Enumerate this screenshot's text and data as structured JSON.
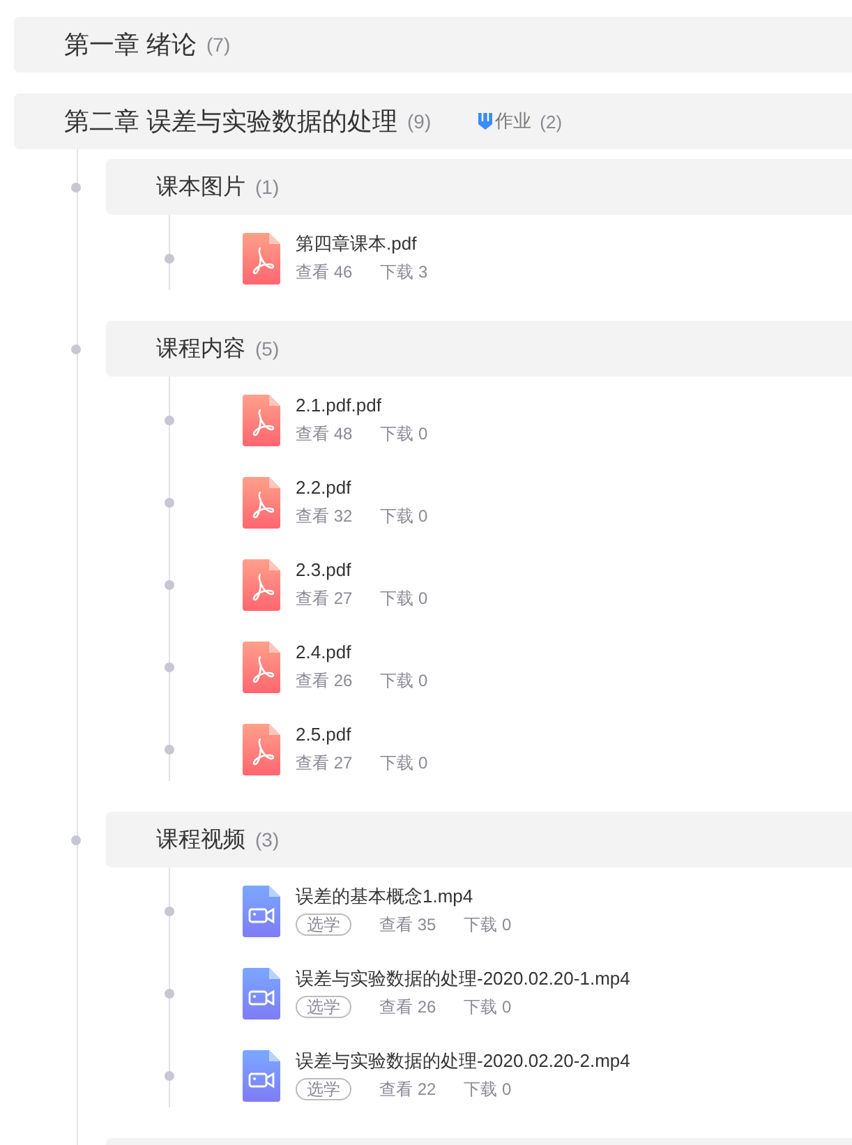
{
  "chapters": [
    {
      "title": "第一章 绪论",
      "count": "(7)"
    },
    {
      "title": "第二章 误差与实验数据的处理",
      "count": "(9)",
      "homework": {
        "label": "作业",
        "count": "(2)"
      },
      "sections": [
        {
          "title": "课本图片",
          "count": "(1)",
          "files": [
            {
              "kind": "pdf",
              "name": "第四章课本.pdf",
              "views": "查看 46",
              "downloads": "下载 3"
            }
          ]
        },
        {
          "title": "课程内容",
          "count": "(5)",
          "files": [
            {
              "kind": "pdf",
              "name": "2.1.pdf.pdf",
              "views": "查看 48",
              "downloads": "下载 0"
            },
            {
              "kind": "pdf",
              "name": "2.2.pdf",
              "views": "查看 32",
              "downloads": "下载 0"
            },
            {
              "kind": "pdf",
              "name": "2.3.pdf",
              "views": "查看 27",
              "downloads": "下载 0"
            },
            {
              "kind": "pdf",
              "name": "2.4.pdf",
              "views": "查看 26",
              "downloads": "下载 0"
            },
            {
              "kind": "pdf",
              "name": "2.5.pdf",
              "views": "查看 27",
              "downloads": "下载 0"
            }
          ]
        },
        {
          "title": "课程视频",
          "count": "(3)",
          "files": [
            {
              "kind": "video",
              "name": "误差的基本概念1.mp4",
              "tag": "选学",
              "views": "查看 35",
              "downloads": "下载 0"
            },
            {
              "kind": "video",
              "name": "误差与实验数据的处理-2020.02.20-1.mp4",
              "tag": "选学",
              "views": "查看 26",
              "downloads": "下载 0"
            },
            {
              "kind": "video",
              "name": "误差与实验数据的处理-2020.02.20-2.mp4",
              "tag": "选学",
              "views": "查看 22",
              "downloads": "下载 0"
            }
          ]
        }
      ]
    }
  ]
}
